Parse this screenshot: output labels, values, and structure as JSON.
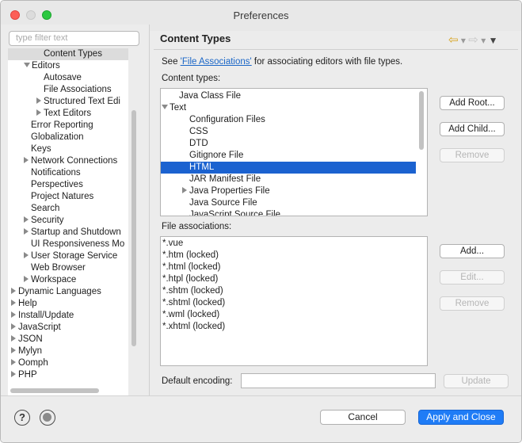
{
  "window": {
    "title": "Preferences"
  },
  "filter": {
    "placeholder": "type filter text"
  },
  "tree": {
    "items": [
      {
        "label": "Content Types",
        "level": 2,
        "expander": "none",
        "selected": true
      },
      {
        "label": "Editors",
        "level": 1,
        "expander": "down"
      },
      {
        "label": "Autosave",
        "level": 2,
        "expander": "none"
      },
      {
        "label": "File Associations",
        "level": 2,
        "expander": "none"
      },
      {
        "label": "Structured Text Edi",
        "level": 2,
        "expander": "right"
      },
      {
        "label": "Text Editors",
        "level": 2,
        "expander": "right"
      },
      {
        "label": "Error Reporting",
        "level": 1,
        "expander": "none"
      },
      {
        "label": "Globalization",
        "level": 1,
        "expander": "none"
      },
      {
        "label": "Keys",
        "level": 1,
        "expander": "none"
      },
      {
        "label": "Network Connections",
        "level": 1,
        "expander": "right"
      },
      {
        "label": "Notifications",
        "level": 1,
        "expander": "none"
      },
      {
        "label": "Perspectives",
        "level": 1,
        "expander": "none"
      },
      {
        "label": "Project Natures",
        "level": 1,
        "expander": "none"
      },
      {
        "label": "Search",
        "level": 1,
        "expander": "none"
      },
      {
        "label": "Security",
        "level": 1,
        "expander": "right"
      },
      {
        "label": "Startup and Shutdown",
        "level": 1,
        "expander": "right"
      },
      {
        "label": "UI Responsiveness Mo",
        "level": 1,
        "expander": "none"
      },
      {
        "label": "User Storage Service",
        "level": 1,
        "expander": "right"
      },
      {
        "label": "Web Browser",
        "level": 1,
        "expander": "none"
      },
      {
        "label": "Workspace",
        "level": 1,
        "expander": "right"
      },
      {
        "label": "Dynamic Languages",
        "level": 0,
        "expander": "right"
      },
      {
        "label": "Help",
        "level": 0,
        "expander": "right"
      },
      {
        "label": "Install/Update",
        "level": 0,
        "expander": "right"
      },
      {
        "label": "JavaScript",
        "level": 0,
        "expander": "right"
      },
      {
        "label": "JSON",
        "level": 0,
        "expander": "right"
      },
      {
        "label": "Mylyn",
        "level": 0,
        "expander": "right"
      },
      {
        "label": "Oomph",
        "level": 0,
        "expander": "right"
      },
      {
        "label": "PHP",
        "level": 0,
        "expander": "right"
      }
    ]
  },
  "page": {
    "title": "Content Types",
    "see_prefix": "See ",
    "see_link": "'File Associations'",
    "see_suffix": " for associating editors with file types.",
    "content_types_label": "Content types:",
    "file_assoc_label": "File associations:",
    "encoding_label": "Default encoding:",
    "encoding_value": ""
  },
  "content_types": {
    "items": [
      {
        "label": "Java Class File",
        "level": 1,
        "expander": "none"
      },
      {
        "label": "Text",
        "level": 0,
        "expander": "down"
      },
      {
        "label": "Configuration Files",
        "level": 2,
        "expander": "none"
      },
      {
        "label": "CSS",
        "level": 2,
        "expander": "none"
      },
      {
        "label": "DTD",
        "level": 2,
        "expander": "none"
      },
      {
        "label": "Gitignore File",
        "level": 2,
        "expander": "none"
      },
      {
        "label": "HTML",
        "level": 2,
        "expander": "none",
        "selected": true
      },
      {
        "label": "JAR Manifest File",
        "level": 2,
        "expander": "none"
      },
      {
        "label": "Java Properties File",
        "level": 2,
        "expander": "right"
      },
      {
        "label": "Java Source File",
        "level": 2,
        "expander": "none"
      },
      {
        "label": "JavaScript Source File",
        "level": 2,
        "expander": "none"
      }
    ]
  },
  "file_associations": [
    "*.vue",
    "*.htm (locked)",
    "*.html (locked)",
    "*.htpl (locked)",
    "*.shtm (locked)",
    "*.shtml (locked)",
    "*.wml (locked)",
    "*.xhtml (locked)"
  ],
  "buttons": {
    "add_root": "Add Root...",
    "add_child": "Add Child...",
    "remove": "Remove",
    "add": "Add...",
    "edit": "Edit...",
    "remove2": "Remove",
    "update": "Update",
    "cancel": "Cancel",
    "apply_close": "Apply and Close"
  },
  "help": {
    "label": "?"
  },
  "colors": {
    "selection": "#1b62d0",
    "accent": "#1f7cf6",
    "link": "#1a66c7"
  },
  "icons": [
    "back-arrow-icon",
    "forward-arrow-icon",
    "view-menu-icon",
    "help-icon",
    "oomph-icon"
  ]
}
